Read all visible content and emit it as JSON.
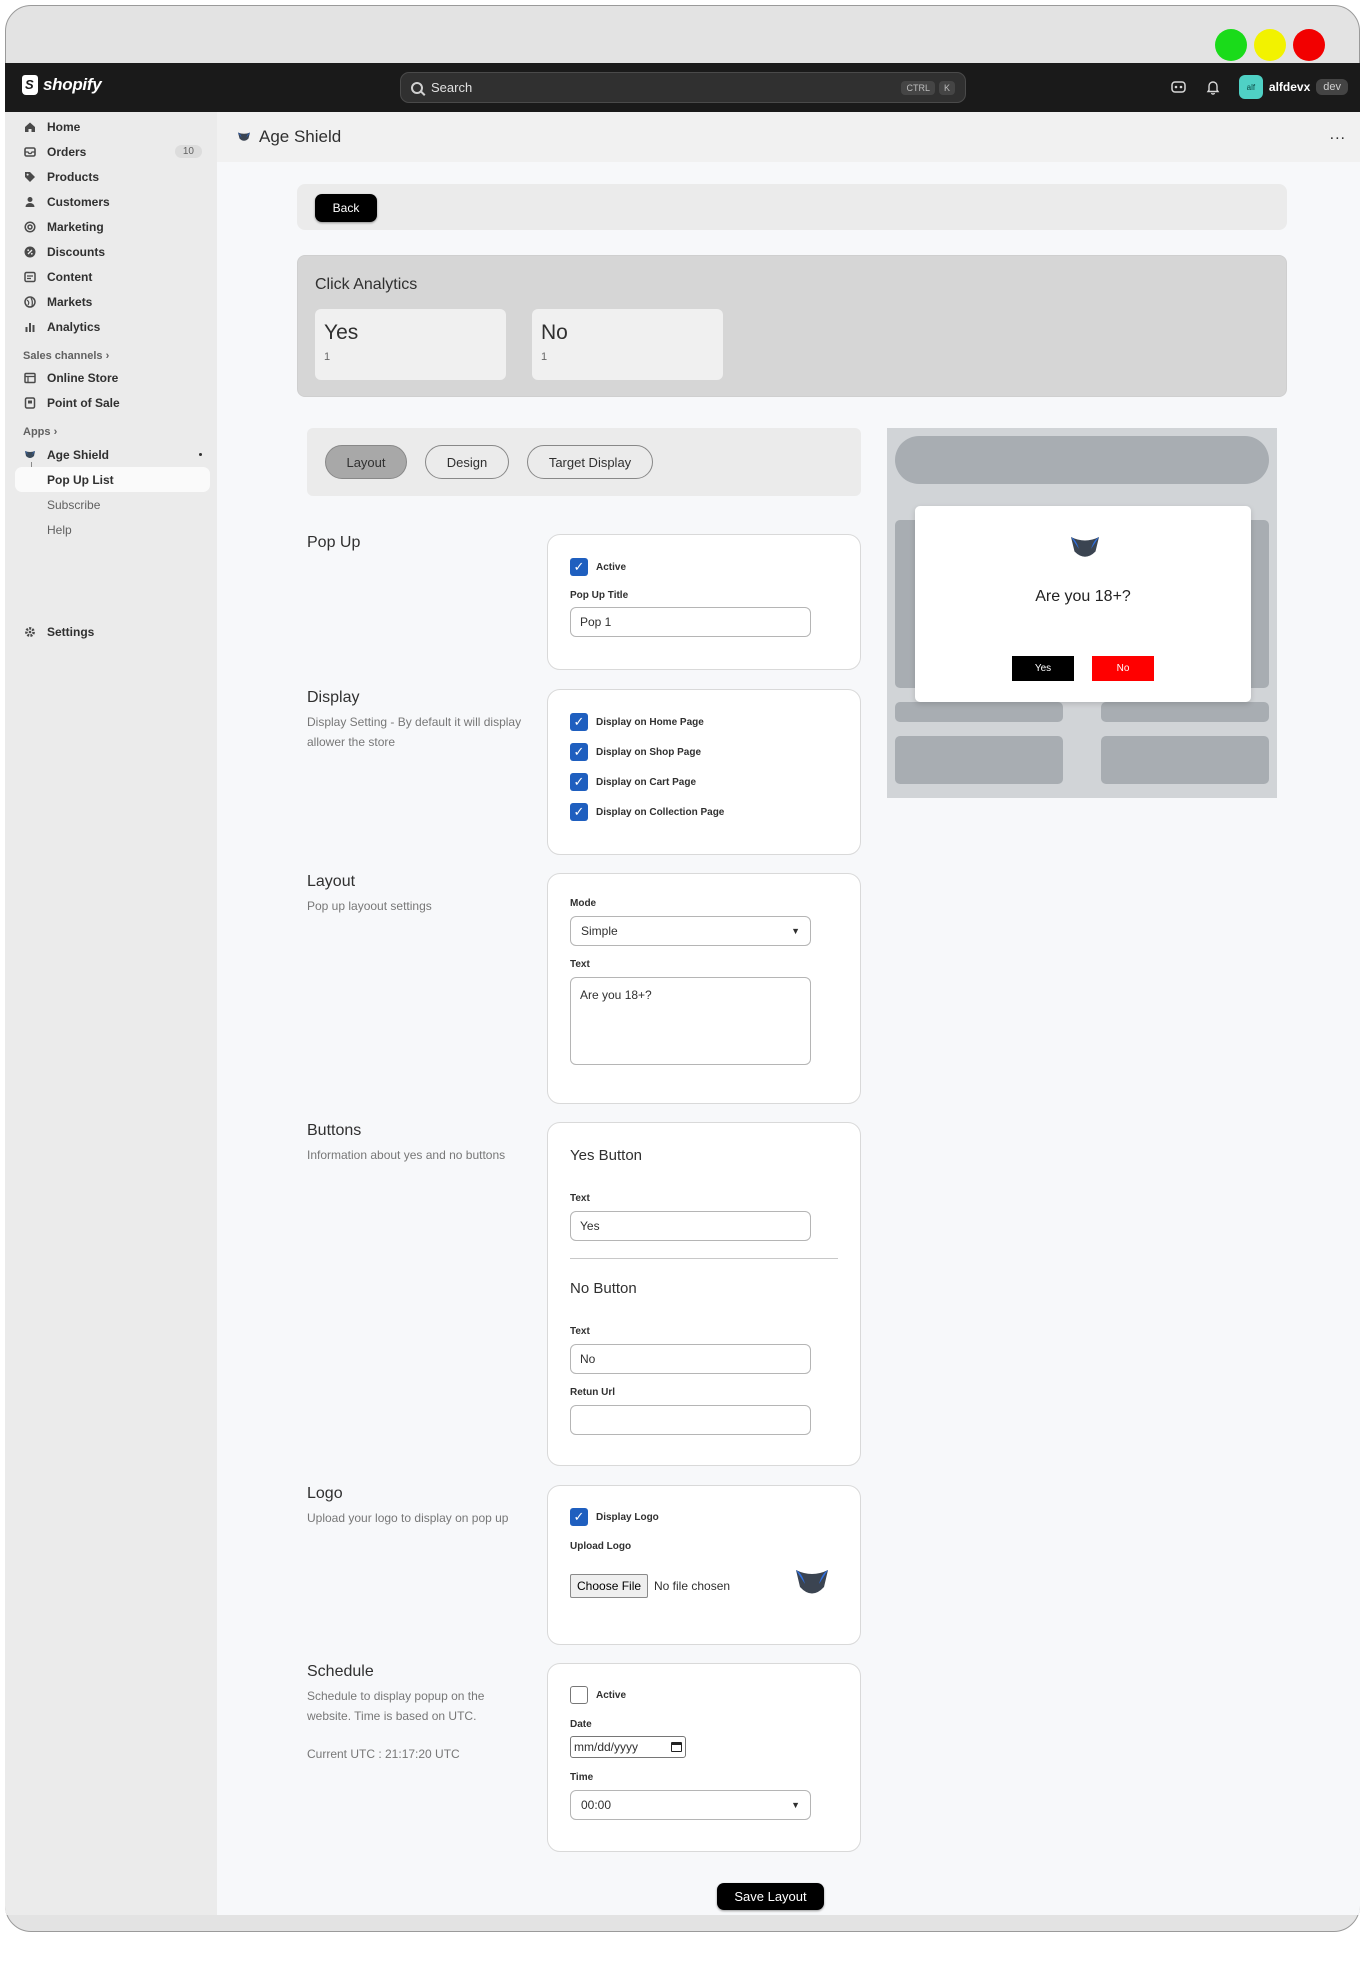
{
  "window": {
    "controls": [
      {
        "name": "green",
        "color": "#1adb1a"
      },
      {
        "name": "yellow",
        "color": "#f2f200"
      },
      {
        "name": "red",
        "color": "#f20000"
      }
    ]
  },
  "topbar": {
    "brand": "shopify",
    "search_placeholder": "Search",
    "kbd": [
      "CTRL",
      "K"
    ],
    "user_initials": "alf",
    "user_name": "alfdevx",
    "user_tag": "dev"
  },
  "sidebar": {
    "items": [
      {
        "label": "Home",
        "icon": "home-icon"
      },
      {
        "label": "Orders",
        "icon": "orders-icon",
        "badge": "10"
      },
      {
        "label": "Products",
        "icon": "tag-icon"
      },
      {
        "label": "Customers",
        "icon": "person-icon"
      },
      {
        "label": "Marketing",
        "icon": "target-icon"
      },
      {
        "label": "Discounts",
        "icon": "discount-icon"
      },
      {
        "label": "Content",
        "icon": "content-icon"
      },
      {
        "label": "Markets",
        "icon": "globe-icon"
      },
      {
        "label": "Analytics",
        "icon": "bar-chart-icon"
      }
    ],
    "sales_channels_label": "Sales channels",
    "channels": [
      {
        "label": "Online Store",
        "icon": "store-icon"
      },
      {
        "label": "Point of Sale",
        "icon": "pos-icon"
      }
    ],
    "apps_label": "Apps",
    "app": {
      "label": "Age Shield",
      "icon": "shield-icon"
    },
    "app_subitems": [
      "Pop Up List",
      "Subscribe",
      "Help"
    ],
    "settings_label": "Settings"
  },
  "header": {
    "title": "Age Shield",
    "more": "..."
  },
  "back_label": "Back",
  "analytics": {
    "title": "Click Analytics",
    "stats": [
      {
        "label": "Yes",
        "value": "1"
      },
      {
        "label": "No",
        "value": "1"
      }
    ]
  },
  "tabs": [
    "Layout",
    "Design",
    "Target Display"
  ],
  "sections": {
    "popup": {
      "title": "Pop Up",
      "active_label": "Active",
      "title_label": "Pop Up Title",
      "title_value": "Pop 1"
    },
    "display": {
      "title": "Display",
      "desc": "Display Setting - By default it will display allower the store",
      "options": [
        "Display on Home Page",
        "Display on Shop Page",
        "Display on Cart Page",
        "Display on Collection Page"
      ]
    },
    "layout": {
      "title": "Layout",
      "desc": "Pop up layoout settings",
      "mode_label": "Mode",
      "mode_value": "Simple",
      "text_label": "Text",
      "text_value": "Are you 18+?"
    },
    "buttons": {
      "title": "Buttons",
      "desc": "Information about yes and no buttons",
      "yes_heading": "Yes Button",
      "yes_text_label": "Text",
      "yes_text_value": "Yes",
      "no_heading": "No Button",
      "no_text_label": "Text",
      "no_text_value": "No",
      "return_label": "Retun Url",
      "return_value": ""
    },
    "logo": {
      "title": "Logo",
      "desc": "Upload your logo to display on pop up",
      "display_label": "Display Logo",
      "upload_label": "Upload Logo",
      "choose_file": "Choose File",
      "no_file": "No file chosen"
    },
    "schedule": {
      "title": "Schedule",
      "desc": "Schedule to display popup on the website. Time is based on UTC.",
      "current_utc": "Current UTC : 21:17:20 UTC",
      "active_label": "Active",
      "date_label": "Date",
      "date_placeholder": "mm/dd/yyyy",
      "time_label": "Time",
      "time_value": "00:00"
    }
  },
  "save_label": "Save Layout",
  "preview": {
    "question": "Are you 18+?",
    "yes": "Yes",
    "no": "No",
    "yes_color": "#000000",
    "no_color": "#ff0000"
  }
}
